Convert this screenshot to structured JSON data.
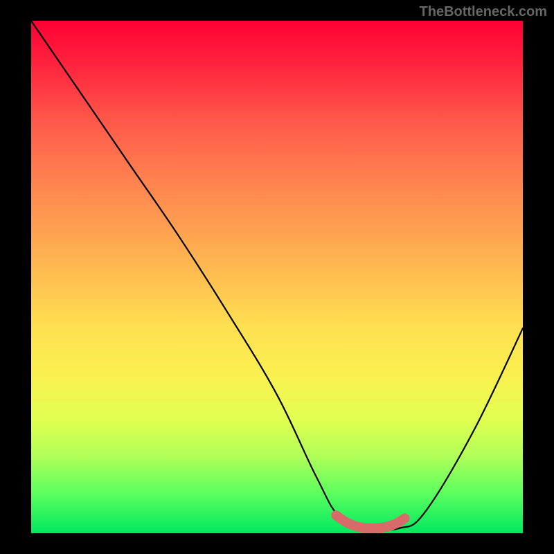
{
  "watermark": "TheBottleneck.com",
  "chart_data": {
    "type": "line",
    "title": "",
    "xlabel": "",
    "ylabel": "",
    "xlim": [
      0,
      100
    ],
    "ylim": [
      0,
      100
    ],
    "series": [
      {
        "name": "bottleneck-curve",
        "x": [
          0,
          10,
          20,
          30,
          40,
          50,
          58,
          63,
          70,
          75,
          80,
          90,
          100
        ],
        "values": [
          100,
          86,
          72,
          58,
          43,
          27,
          11,
          3,
          1,
          1,
          4,
          20,
          40
        ]
      }
    ],
    "highlight": {
      "name": "optimal-range",
      "x": [
        62,
        64,
        66,
        68,
        70,
        72,
        74,
        76
      ],
      "values": [
        3.5,
        2.2,
        1.4,
        1.0,
        1.0,
        1.2,
        1.8,
        2.9
      ],
      "color": "#d86a6a"
    },
    "gradient_stops": [
      {
        "pct": 0,
        "color": "#ff0033"
      },
      {
        "pct": 50,
        "color": "#ffbf50"
      },
      {
        "pct": 78,
        "color": "#e0ff50"
      },
      {
        "pct": 100,
        "color": "#00e860"
      }
    ]
  }
}
